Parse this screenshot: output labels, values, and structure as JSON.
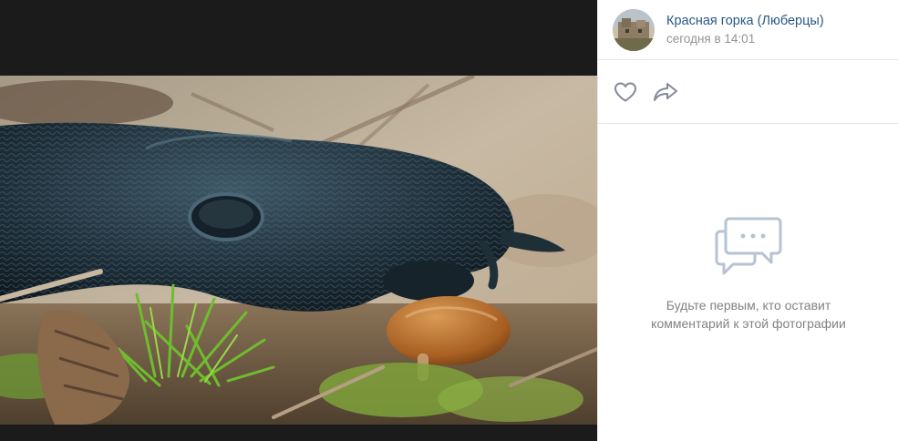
{
  "photo": {
    "alt_icon": "slug-photo"
  },
  "author": {
    "name": "Красная горка (Люберцы)",
    "date": "сегодня в 14:01",
    "avatar_icon": "community-avatar"
  },
  "actions": {
    "like_icon": "heart-icon",
    "share_icon": "share-arrow-icon"
  },
  "comments": {
    "empty_icon": "comments-bubble-icon",
    "empty_line1": "Будьте первым, кто оставит",
    "empty_line2": "комментарий к этой фотографии"
  },
  "colors": {
    "viewer_bg": "#1b1b1b",
    "link": "#2a5885",
    "muted": "#939393",
    "icon": "#828a99",
    "divider": "#e7e8ec"
  }
}
